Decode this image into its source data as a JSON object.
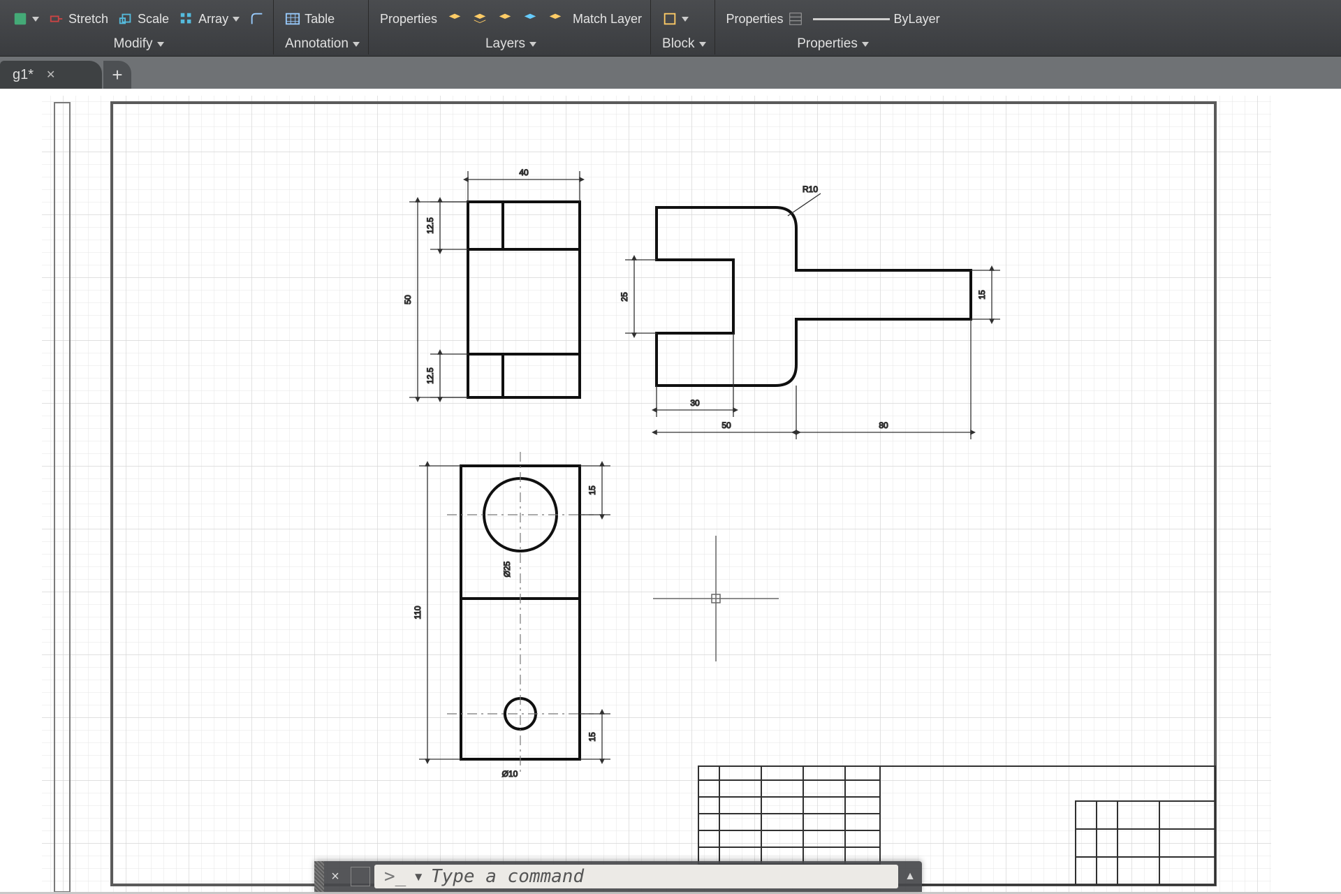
{
  "ribbon": {
    "modify": {
      "title": "Modify",
      "stretch": "Stretch",
      "scale": "Scale",
      "array": "Array"
    },
    "annotation": {
      "title": "Annotation",
      "table": "Table"
    },
    "layers": {
      "title": "Layers",
      "properties": "Properties",
      "match": "Match Layer"
    },
    "block": {
      "title": "Block"
    },
    "properties": {
      "title": "Properties",
      "btn": "Properties",
      "linetype": "ByLayer"
    }
  },
  "tabs": {
    "active": "g1*",
    "new": "+"
  },
  "cmdline": {
    "close": "×",
    "caret": ">_",
    "bullet": "▾",
    "placeholder": "Type a command",
    "expand": "▲"
  },
  "drawing": {
    "dims": {
      "top_width": "40",
      "top_h1": "12.5",
      "top_mid": "50",
      "top_h2": "12.5",
      "fork_radius": "R10",
      "fork_gap": "25",
      "fork_height": "15",
      "fork_notch": "30",
      "fork_left": "50",
      "fork_right": "80",
      "plan_total": "110",
      "plan_top": "15",
      "plan_bot": "15",
      "plan_bighole": "Ø25",
      "plan_smallhole": "Ø10"
    }
  }
}
